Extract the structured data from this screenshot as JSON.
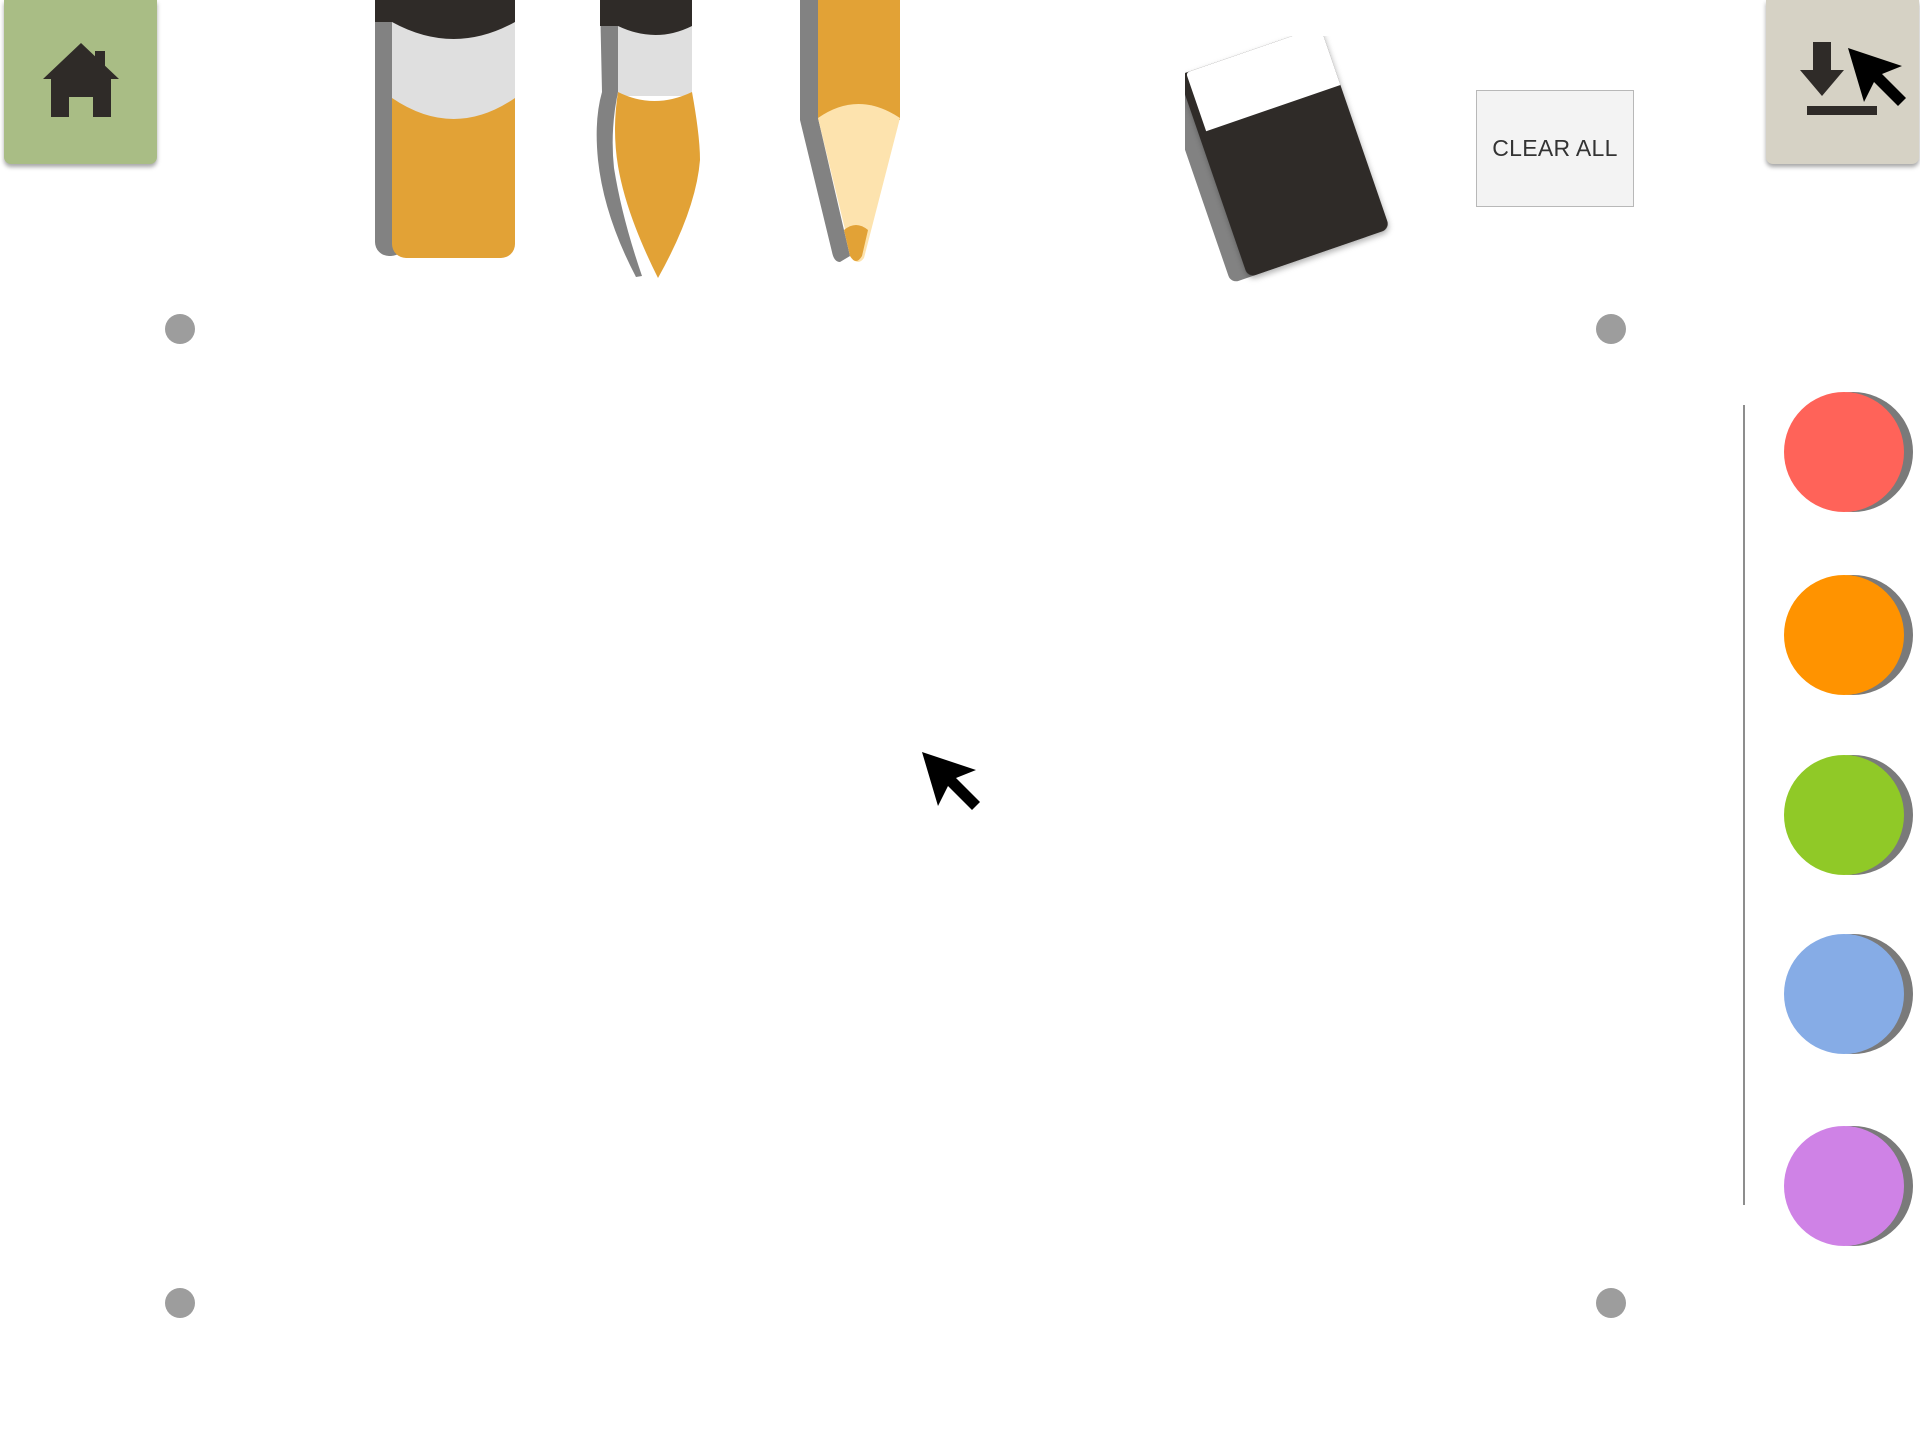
{
  "toolbar": {
    "home": {
      "icon": "home-icon",
      "bg": "#a9bd85"
    },
    "download": {
      "icon": "download-icon",
      "bg": "#d6d2c5"
    },
    "tools": [
      {
        "name": "marker",
        "icon": "marker-icon"
      },
      {
        "name": "brush",
        "icon": "paintbrush-icon"
      },
      {
        "name": "pencil",
        "icon": "pencil-icon"
      },
      {
        "name": "eraser",
        "icon": "eraser-icon"
      }
    ],
    "clear_all_label": "CLEAR ALL"
  },
  "palette": {
    "colors": [
      "#ff6359",
      "#ff9300",
      "#90c927",
      "#86ace6",
      "#cf82e6"
    ]
  },
  "colors": {
    "tool_body": "#e2a236",
    "tool_dark": "#2f2b28",
    "tool_band": "#dfdfdf",
    "tool_shadow": "#828282",
    "pencil_wood": "#fde3ae",
    "corner_marker": "#9d9d9d",
    "divider": "#8d8d8d"
  }
}
